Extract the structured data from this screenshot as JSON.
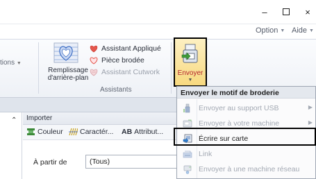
{
  "window": {
    "minimize": "–",
    "close": "×"
  },
  "menu": {
    "option": "Option",
    "aide": "Aide"
  },
  "ribbon": {
    "left_partial": "tions",
    "remplissage_label_1": "Remplissage",
    "remplissage_label_2": "d'arrière-plan",
    "assistant_applique": "Assistant Appliqué",
    "piece_brodee": "Pièce brodée",
    "assistant_cutwork": "Assistant Cutwork",
    "assistants_caption": "Assistants",
    "envoyer_label": "Envoyer"
  },
  "panel": {
    "import_header": "Importer",
    "tools": {
      "couleur": "Couleur",
      "caracteres": "Caractér...",
      "attributs_prefix": "AB",
      "attributs": "Attribut..."
    },
    "from_label": "À partir de",
    "from_value": "(Tous)"
  },
  "dropdown": {
    "title": "Envoyer le motif de broderie",
    "items": [
      {
        "label": "Envoyer au support USB",
        "enabled": false,
        "submenu": true
      },
      {
        "label": "Envoyer à votre machine",
        "enabled": false,
        "submenu": true
      },
      {
        "label": "Écrire sur carte",
        "enabled": true,
        "submenu": false
      },
      {
        "label": "Link",
        "enabled": false,
        "submenu": false
      },
      {
        "label": "Envoyer à une machine réseau",
        "enabled": false,
        "submenu": false
      }
    ]
  },
  "colors": {
    "accent_red": "#b4262d",
    "envoyer_bg": "#f7d980",
    "disabled_text": "#a3a9b3"
  },
  "icons": [
    "heart-icon",
    "usb-icon",
    "machine-icon",
    "card-write-icon",
    "link-icon",
    "network-machine-icon",
    "color-icon",
    "characters-icon"
  ]
}
